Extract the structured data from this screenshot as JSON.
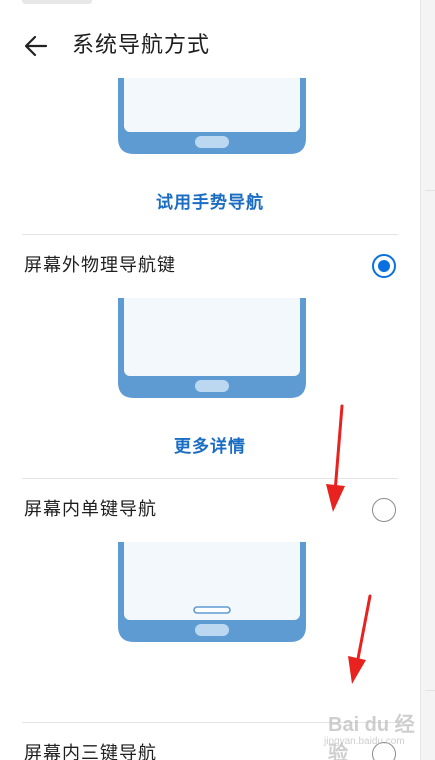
{
  "header": {
    "title": "系统导航方式"
  },
  "options": [
    {
      "label": "屏幕外物理导航键",
      "selected": true
    },
    {
      "label": "屏幕内单键导航",
      "selected": false
    },
    {
      "label": "屏幕内三键导航",
      "selected": false
    }
  ],
  "links": {
    "gesture_try": "试用手势导航",
    "more_details": "更多详情"
  },
  "watermark": {
    "logo": "Bai du 经验",
    "url": "jingyan.baidu.com"
  },
  "colors": {
    "accent": "#0a6fe0",
    "link": "#1a6dc2",
    "phone_frame": "#5e9bd3",
    "phone_screen": "#f3f8fd",
    "phone_button": "#bcd8f0",
    "annotation_arrow": "#e8221f"
  },
  "icons": {
    "back": "arrow-left-icon",
    "radio_on": "radio-checked-icon",
    "radio_off": "radio-unchecked-icon"
  }
}
